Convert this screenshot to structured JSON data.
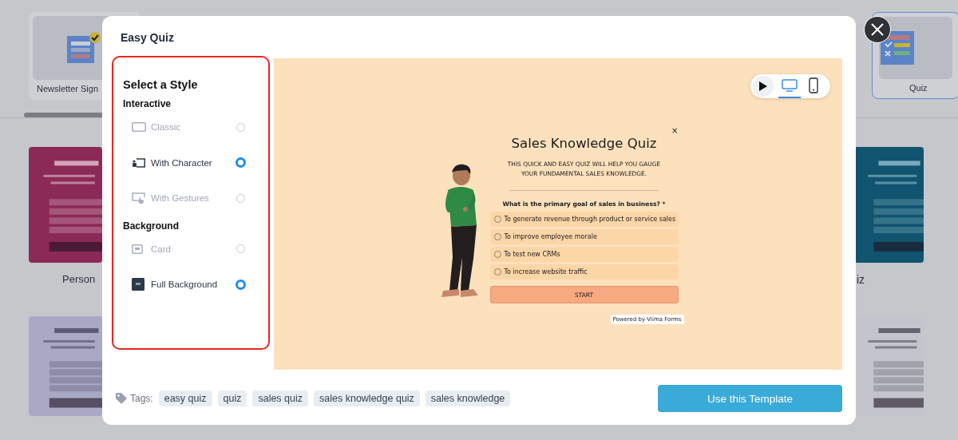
{
  "gallery": {
    "categories": [
      {
        "label": "Newsletter Sign",
        "selected": false
      },
      {
        "label": "Quiz",
        "selected": true
      }
    ],
    "templates": [
      {
        "label": "Person"
      },
      {
        "label": "iz"
      }
    ]
  },
  "modal": {
    "title": "Easy Quiz"
  },
  "style_panel": {
    "heading": "Select a Style",
    "groups": [
      {
        "heading": "Interactive",
        "options": [
          {
            "label": "Classic",
            "kind": "classic",
            "selected": false
          },
          {
            "label": "With Character",
            "kind": "character",
            "selected": true
          },
          {
            "label": "With Gestures",
            "kind": "gestures",
            "selected": false
          }
        ]
      },
      {
        "heading": "Background",
        "options": [
          {
            "label": "Card",
            "kind": "card",
            "selected": false
          },
          {
            "label": "Full Background",
            "kind": "full",
            "selected": true
          }
        ]
      }
    ]
  },
  "preview": {
    "devices": [
      {
        "kind": "desktop",
        "selected": true
      },
      {
        "kind": "mobile",
        "selected": false
      }
    ],
    "quiz": {
      "close": "×",
      "title": "Sales Knowledge Quiz",
      "subtitle": "THIS QUICK AND EASY QUIZ WILL HELP YOU GAUGE YOUR FUNDAMENTAL SALES KNOWLEDGE.",
      "question": "What is the primary goal of sales in business? *",
      "options": [
        {
          "label": "To generate revenue through product or service sales",
          "selected": false
        },
        {
          "label": "To improve employee morale",
          "selected": false
        },
        {
          "label": "To test new CRMs",
          "selected": false
        },
        {
          "label": "To increase website traffic",
          "selected": false
        }
      ],
      "start": "START",
      "powered": "Powered by Viima Forms"
    }
  },
  "tags": {
    "label": "Tags:",
    "items": [
      "easy quiz",
      "quiz",
      "sales quiz",
      "sales knowledge quiz",
      "sales knowledge"
    ]
  },
  "action": "Use this Template"
}
